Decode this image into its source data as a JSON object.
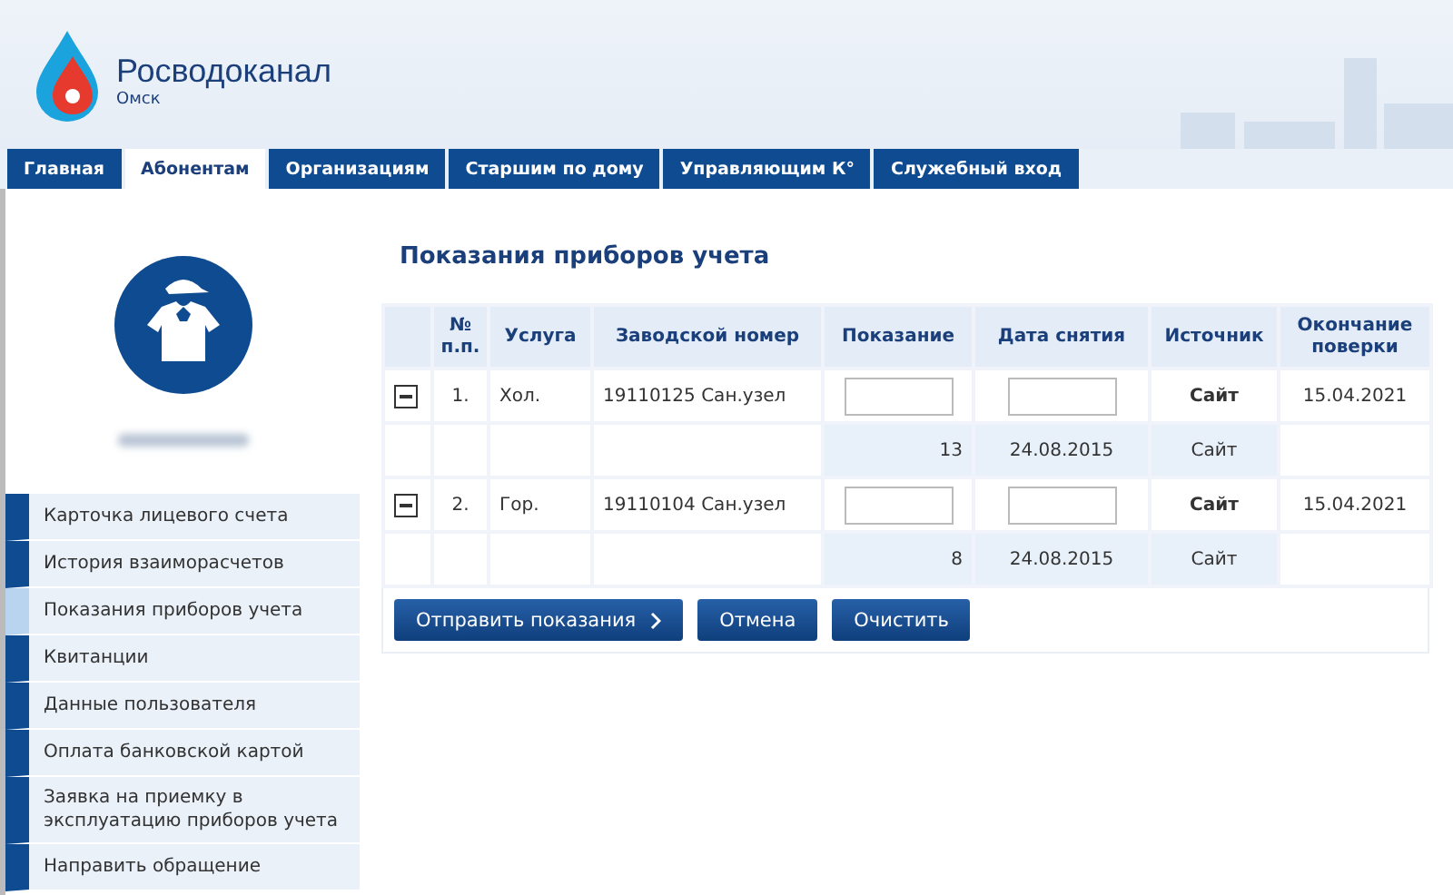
{
  "logo": {
    "name": "Росводоканал",
    "city": "Омск"
  },
  "tabs": [
    {
      "label": "Главная",
      "selected": false
    },
    {
      "label": "Абонентам",
      "selected": true
    },
    {
      "label": "Организациям",
      "selected": false
    },
    {
      "label": "Старшим по дому",
      "selected": false
    },
    {
      "label": "Управляющим К°",
      "selected": false
    },
    {
      "label": "Служебный вход",
      "selected": false
    }
  ],
  "sidebar": {
    "items": [
      {
        "label": "Карточка лицевого счета",
        "selected": false
      },
      {
        "label": "История взаиморасчетов",
        "selected": false
      },
      {
        "label": "Показания приборов учета",
        "selected": true
      },
      {
        "label": "Квитанции",
        "selected": false
      },
      {
        "label": "Данные пользователя",
        "selected": false
      },
      {
        "label": "Оплата банковской картой",
        "selected": false
      },
      {
        "label": "Заявка на приемку в эксплуатацию приборов учета",
        "selected": false
      },
      {
        "label": "Направить обращение",
        "selected": false
      }
    ]
  },
  "page_title": "Показания приборов учета",
  "table": {
    "columns": [
      "№ п.п.",
      "Услуга",
      "Заводской номер",
      "Показание",
      "Дата снятия",
      "Источник",
      "Окончание поверки"
    ],
    "rows": [
      {
        "expanded": true,
        "number": "1.",
        "service": "Хол.",
        "serial": "19110125 Сан.узел",
        "source": "Сайт",
        "verification_end": "15.04.2021",
        "history": {
          "reading": "13",
          "date": "24.08.2015",
          "source": "Сайт"
        }
      },
      {
        "expanded": true,
        "number": "2.",
        "service": "Гор.",
        "serial": "19110104 Сан.узел",
        "source": "Сайт",
        "verification_end": "15.04.2021",
        "history": {
          "reading": "8",
          "date": "24.08.2015",
          "source": "Сайт"
        }
      }
    ]
  },
  "buttons": [
    {
      "label": "Отправить показания",
      "kind": "next"
    },
    {
      "label": "Отмена",
      "kind": "plain"
    },
    {
      "label": "Очистить",
      "kind": "plain"
    }
  ]
}
